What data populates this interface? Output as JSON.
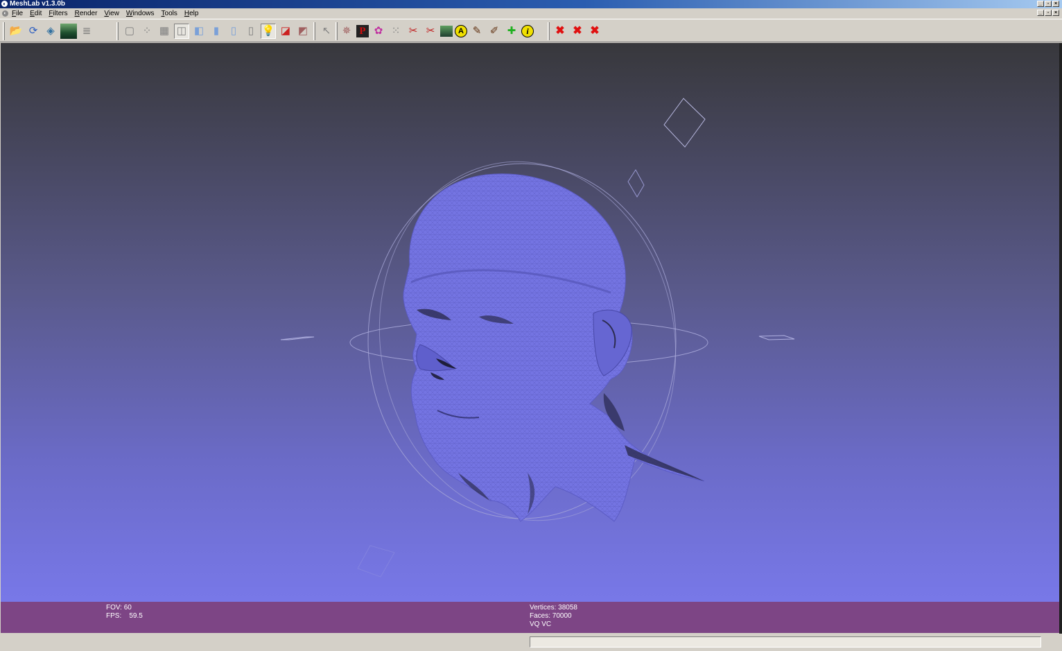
{
  "window": {
    "title": "MeshLab v1.3.0b",
    "app_icon": "meshlab-icon",
    "title_buttons": [
      "minimize",
      "restore",
      "close"
    ]
  },
  "menubar": {
    "items": [
      "File",
      "Edit",
      "Filters",
      "Render",
      "View",
      "Windows",
      "Tools",
      "Help"
    ],
    "doc_buttons": [
      "minimize",
      "restore",
      "close"
    ]
  },
  "toolbar": {
    "groups": [
      {
        "name": "file",
        "buttons": [
          {
            "icon": "open-folder-icon",
            "glyph": "📂"
          },
          {
            "icon": "reload-icon",
            "glyph": "⟳"
          },
          {
            "icon": "save-icon",
            "glyph": "◈"
          },
          {
            "icon": "snapshot-icon",
            "glyph": ""
          },
          {
            "icon": "layers-icon",
            "glyph": "≣"
          }
        ]
      },
      {
        "name": "render-mode",
        "buttons": [
          {
            "icon": "bounding-box-icon",
            "glyph": "▢"
          },
          {
            "icon": "points-icon",
            "glyph": "⁘"
          },
          {
            "icon": "wireframe-icon",
            "glyph": "▦"
          },
          {
            "icon": "hidden-lines-icon",
            "glyph": "◫",
            "active": true
          },
          {
            "icon": "flat-lines-icon",
            "glyph": "◧"
          },
          {
            "icon": "flat-icon",
            "glyph": "▮"
          },
          {
            "icon": "smooth-icon",
            "glyph": "▯"
          },
          {
            "icon": "texture-icon",
            "glyph": "▯"
          },
          {
            "icon": "light-icon",
            "glyph": "💡",
            "active": true
          },
          {
            "icon": "double-side-lighting-icon",
            "glyph": "◪"
          },
          {
            "icon": "backface-culling-icon",
            "glyph": "◩"
          }
        ]
      },
      {
        "name": "pick",
        "buttons": [
          {
            "icon": "pick-pointer-icon",
            "glyph": "↖"
          }
        ]
      },
      {
        "name": "edit-tools",
        "buttons": [
          {
            "icon": "manipulator-icon",
            "glyph": "✵"
          },
          {
            "icon": "paint-p-icon",
            "glyph": "P"
          },
          {
            "icon": "color-select-icon",
            "glyph": "✿"
          },
          {
            "icon": "select-vertices-icon",
            "glyph": "⁙"
          },
          {
            "icon": "select-faces-icon",
            "glyph": "✂"
          },
          {
            "icon": "select-connected-icon",
            "glyph": "✂"
          },
          {
            "icon": "background-picture-icon",
            "glyph": ""
          },
          {
            "icon": "annotation-icon",
            "glyph": "A"
          },
          {
            "icon": "align-icon",
            "glyph": "✎"
          },
          {
            "icon": "paint-brush-icon",
            "glyph": "✐"
          },
          {
            "icon": "quality-mapper-icon",
            "glyph": "✚"
          },
          {
            "icon": "info-icon",
            "glyph": "i"
          }
        ]
      },
      {
        "name": "delete",
        "buttons": [
          {
            "icon": "delete-faces-icon",
            "glyph": "✖"
          },
          {
            "icon": "delete-faces-vertices-icon",
            "glyph": "✖"
          },
          {
            "icon": "delete-all-icon",
            "glyph": "✖"
          }
        ]
      }
    ]
  },
  "viewport": {
    "background_top": "#38383c",
    "background_bottom": "#7878e8",
    "mesh_color": "#7070e0"
  },
  "info": {
    "fov_label": "FOV: 60",
    "fps_label": "FPS:    59.5",
    "vertices_label": "Vertices: 38058",
    "faces_label": "Faces: 70000",
    "flags_label": "VQ VC"
  },
  "statusbar": {
    "message": ""
  }
}
